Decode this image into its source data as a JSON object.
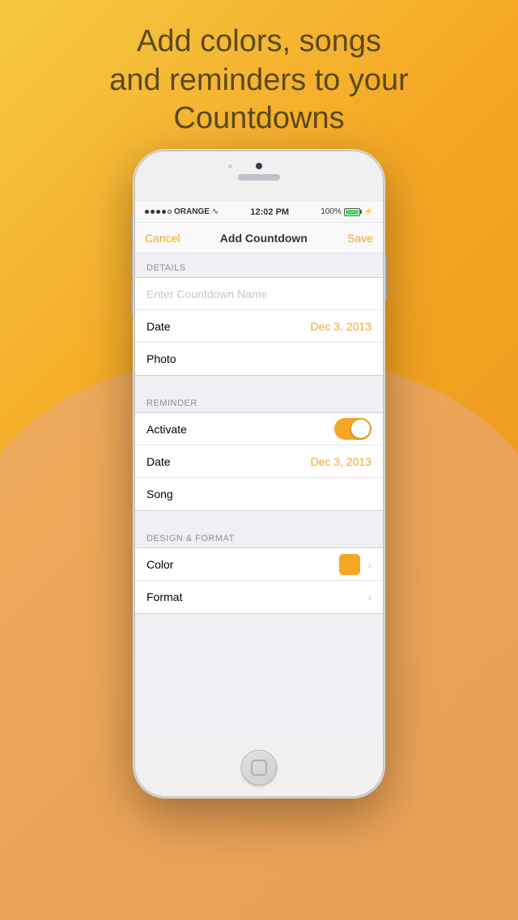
{
  "background": {
    "color1": "#F5C842",
    "color2": "#F5A623",
    "color3": "#E8921A"
  },
  "headline": {
    "line1": "Add colors, songs",
    "line2": "and reminders to your",
    "line3": "Countdowns"
  },
  "status_bar": {
    "signal_carrier": "ORANGE",
    "time": "12:02 PM",
    "battery_pct": "100%"
  },
  "nav": {
    "cancel": "Cancel",
    "title": "Add Countdown",
    "save": "Save"
  },
  "sections": {
    "details": {
      "header": "DETAILS",
      "name_placeholder": "Enter Countdown Name",
      "date_label": "Date",
      "date_value": "Dec 3, 2013",
      "photo_label": "Photo"
    },
    "reminder": {
      "header": "REMINDER",
      "activate_label": "Activate",
      "date_label": "Date",
      "date_value": "Dec 3, 2013",
      "song_label": "Song"
    },
    "design": {
      "header": "DESIGN & FORMAT",
      "color_label": "Color",
      "format_label": "Format"
    }
  },
  "icons": {
    "chevron": "›",
    "wifi": "≋"
  }
}
